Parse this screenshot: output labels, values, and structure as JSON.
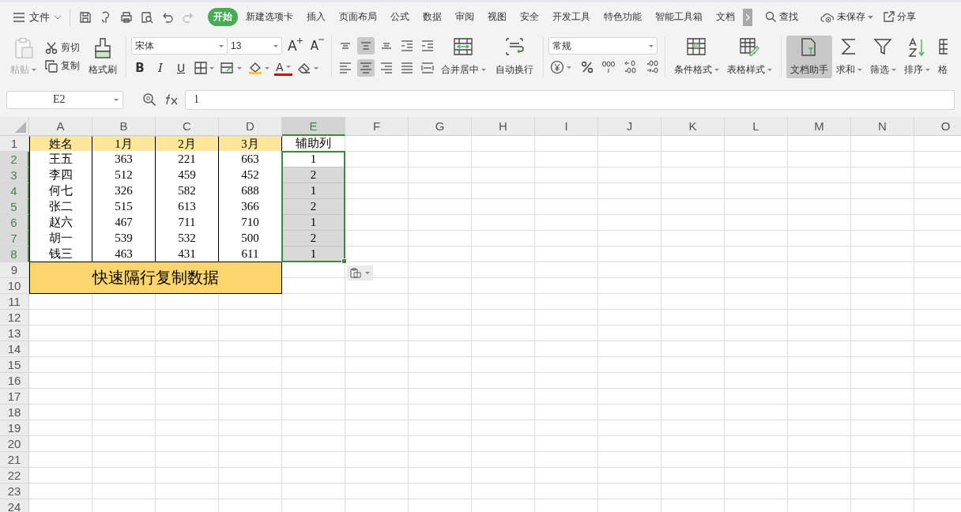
{
  "menu": {
    "file_label": "文件",
    "tabs": [
      {
        "label": "开始",
        "selected": true
      },
      {
        "label": "新建选项卡",
        "selected": false
      },
      {
        "label": "插入",
        "selected": false
      },
      {
        "label": "页面布局",
        "selected": false
      },
      {
        "label": "公式",
        "selected": false
      },
      {
        "label": "数据",
        "selected": false
      },
      {
        "label": "审阅",
        "selected": false
      },
      {
        "label": "视图",
        "selected": false
      },
      {
        "label": "安全",
        "selected": false
      },
      {
        "label": "开发工具",
        "selected": false
      },
      {
        "label": "特色功能",
        "selected": false
      },
      {
        "label": "智能工具箱",
        "selected": false
      },
      {
        "label": "文档",
        "selected": false
      }
    ],
    "search_label": "查找",
    "save_status": "未保存",
    "share_label": "分享"
  },
  "ribbon": {
    "paste": {
      "label": "粘贴",
      "disabled": true
    },
    "cut_label": "剪切",
    "copy_label": "复制",
    "format_painter_label": "格式刷",
    "font_name": "宋体",
    "font_size": "13",
    "grow_label": "A",
    "shrink_label": "A",
    "style_buttons": [
      {
        "kind": "bold",
        "label": "B"
      },
      {
        "kind": "italic",
        "label": "I"
      },
      {
        "kind": "underline",
        "label": "U"
      }
    ],
    "font_color_label": "A",
    "align_top": [
      {
        "kind": "top",
        "selected": false
      },
      {
        "kind": "middle",
        "selected": true
      },
      {
        "kind": "bottom",
        "selected": false
      },
      {
        "kind": "outdent",
        "selected": false
      },
      {
        "kind": "indent",
        "selected": false
      }
    ],
    "align_bottom": [
      {
        "kind": "left",
        "selected": false
      },
      {
        "kind": "center",
        "selected": true
      },
      {
        "kind": "right",
        "selected": false
      },
      {
        "kind": "justify",
        "selected": false
      },
      {
        "kind": "distributed",
        "selected": false
      }
    ],
    "merge_label": "合并居中",
    "wrap_label": "自动换行",
    "number_format": "常规",
    "tools": [
      {
        "kind": "conditional",
        "label": "条件格式",
        "dropdown": true,
        "selected": false
      },
      {
        "kind": "table-style",
        "label": "表格样式",
        "dropdown": true,
        "selected": false
      },
      {
        "kind": "assistant",
        "label": "文档助手",
        "dropdown": false,
        "selected": true
      },
      {
        "kind": "sum",
        "label": "求和",
        "dropdown": true,
        "selected": false
      },
      {
        "kind": "filter",
        "label": "筛选",
        "dropdown": true,
        "selected": false
      },
      {
        "kind": "sort",
        "label": "排序",
        "dropdown": true,
        "selected": false
      },
      {
        "kind": "format",
        "label": "格",
        "dropdown": false,
        "selected": false
      }
    ]
  },
  "formula_bar": {
    "name_box": "E2",
    "formula": "1"
  },
  "sheet": {
    "columns": [
      {
        "label": "A",
        "selected": false
      },
      {
        "label": "B",
        "selected": false
      },
      {
        "label": "C",
        "selected": false
      },
      {
        "label": "D",
        "selected": false
      },
      {
        "label": "E",
        "selected": true
      },
      {
        "label": "F",
        "selected": false
      },
      {
        "label": "G",
        "selected": false
      },
      {
        "label": "H",
        "selected": false
      },
      {
        "label": "I",
        "selected": false
      },
      {
        "label": "J",
        "selected": false
      },
      {
        "label": "K",
        "selected": false
      },
      {
        "label": "L",
        "selected": false
      },
      {
        "label": "M",
        "selected": false
      },
      {
        "label": "N",
        "selected": false
      },
      {
        "label": "O",
        "selected": false
      }
    ],
    "rows": [
      {
        "label": "1",
        "kind": "header",
        "selected": false,
        "cells": [
          "姓名",
          "1月",
          "2月",
          "3月",
          "辅助列"
        ]
      },
      {
        "label": "2",
        "kind": "data",
        "selected": true,
        "active": true,
        "cells": [
          "王五",
          "363",
          "221",
          "663",
          "1"
        ]
      },
      {
        "label": "3",
        "kind": "data",
        "selected": true,
        "active": false,
        "cells": [
          "李四",
          "512",
          "459",
          "452",
          "2"
        ]
      },
      {
        "label": "4",
        "kind": "data",
        "selected": true,
        "active": false,
        "cells": [
          "何七",
          "326",
          "582",
          "688",
          "1"
        ]
      },
      {
        "label": "5",
        "kind": "data",
        "selected": true,
        "active": false,
        "cells": [
          "张二",
          "515",
          "613",
          "366",
          "2"
        ]
      },
      {
        "label": "6",
        "kind": "data",
        "selected": true,
        "active": false,
        "cells": [
          "赵六",
          "467",
          "711",
          "710",
          "1"
        ]
      },
      {
        "label": "7",
        "kind": "data",
        "selected": true,
        "active": false,
        "cells": [
          "胡一",
          "539",
          "532",
          "500",
          "2"
        ]
      },
      {
        "label": "8",
        "kind": "data",
        "selected": true,
        "active": false,
        "cells": [
          "钱三",
          "463",
          "431",
          "611",
          "1"
        ]
      },
      {
        "label": "9",
        "kind": "banner",
        "selected": false,
        "cells": [
          "快速隔行复制数据"
        ]
      },
      {
        "label": "10",
        "kind": "empty",
        "selected": false
      },
      {
        "label": "11",
        "kind": "empty",
        "selected": false
      },
      {
        "label": "12",
        "kind": "empty",
        "selected": false
      },
      {
        "label": "13",
        "kind": "empty",
        "selected": false
      },
      {
        "label": "14",
        "kind": "empty",
        "selected": false
      },
      {
        "label": "15",
        "kind": "empty",
        "selected": false
      },
      {
        "label": "16",
        "kind": "empty",
        "selected": false
      },
      {
        "label": "17",
        "kind": "empty",
        "selected": false
      },
      {
        "label": "18",
        "kind": "empty",
        "selected": false
      },
      {
        "label": "19",
        "kind": "empty",
        "selected": false
      },
      {
        "label": "20",
        "kind": "empty",
        "selected": false
      },
      {
        "label": "21",
        "kind": "empty",
        "selected": false
      },
      {
        "label": "22",
        "kind": "empty",
        "selected": false
      },
      {
        "label": "23",
        "kind": "empty",
        "selected": false
      },
      {
        "label": "24",
        "kind": "empty",
        "selected": false
      }
    ]
  }
}
